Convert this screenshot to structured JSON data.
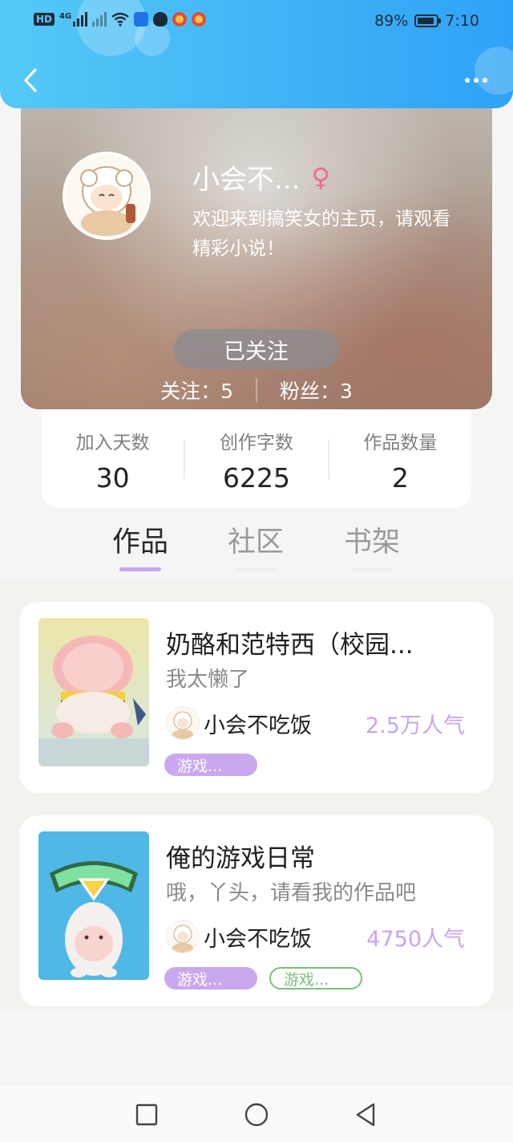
{
  "status_bar": {
    "network_label": "HD",
    "signal_label": "4G",
    "battery": "89%",
    "time": "7:10"
  },
  "header": {
    "back_icon": "chevron-left-icon",
    "more_icon": "more-dots-icon"
  },
  "profile": {
    "nickname": "小会不...",
    "gender_symbol": "♀",
    "bio": "欢迎来到搞笑女的主页，请观看精彩小说！",
    "follow_button": "已关注",
    "following_text": "关注：5",
    "fans_text": "粉丝：3"
  },
  "stats": [
    {
      "label": "加入天数",
      "value": "30"
    },
    {
      "label": "创作字数",
      "value": "6225"
    },
    {
      "label": "作品数量",
      "value": "2"
    }
  ],
  "tabs": [
    {
      "label": "作品",
      "active": true
    },
    {
      "label": "社区",
      "active": false
    },
    {
      "label": "书架",
      "active": false
    }
  ],
  "works": [
    {
      "title": "奶酪和范特西（校园...",
      "description": "我太懒了",
      "author": "小会不吃饭",
      "popularity": "2.5万人气",
      "tags": [
        {
          "label": "游戏...",
          "style": "purple"
        }
      ]
    },
    {
      "title": "俺的游戏日常",
      "description": "哦，丫头，请看我的作品吧",
      "author": "小会不吃饭",
      "popularity": "4750人气",
      "tags": [
        {
          "label": "游戏...",
          "style": "purple"
        },
        {
          "label": "游戏...",
          "style": "green"
        }
      ]
    }
  ],
  "colors": {
    "header_blue": "#3fb1f6",
    "accent_purple": "#c9a4ee",
    "tag_green": "#7cc07c",
    "gender_pink": "#f26a8d"
  },
  "system_nav": {
    "recents_icon": "square-icon",
    "home_icon": "circle-icon",
    "back_icon": "triangle-back-icon"
  }
}
